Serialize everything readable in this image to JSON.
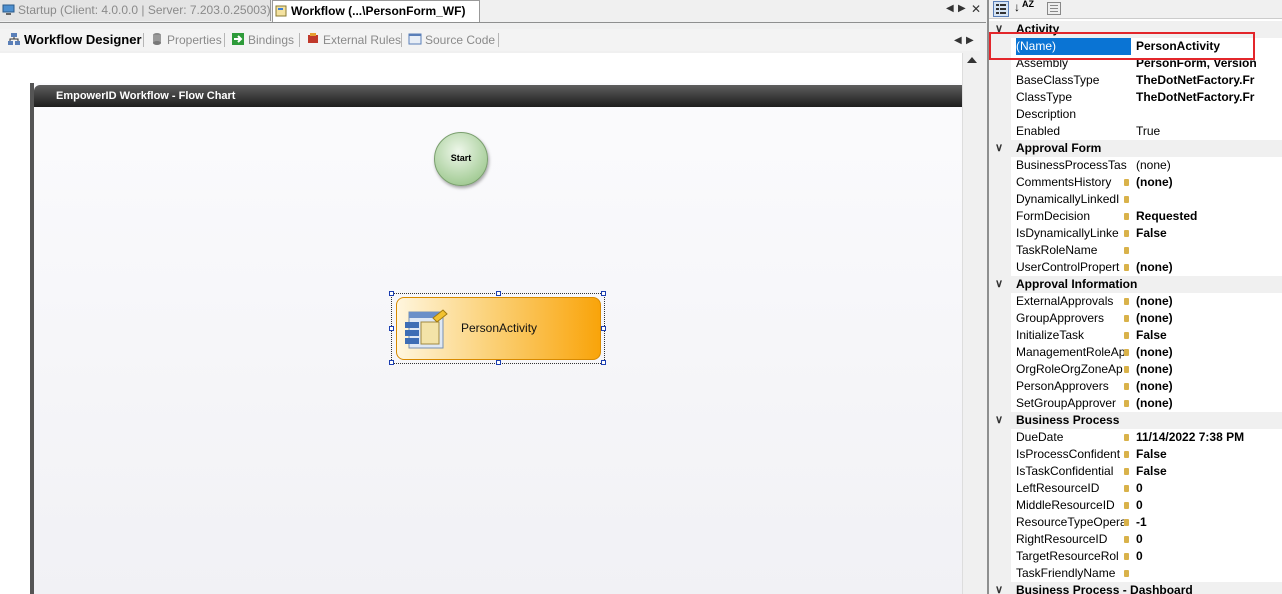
{
  "doc_tabs": [
    {
      "label": "Startup (Client: 4.0.0.0 | Server: 7.203.0.25003)",
      "active": false
    },
    {
      "label": "Workflow (...\\PersonForm_WF)",
      "active": true
    }
  ],
  "sub_tabs": [
    {
      "label": "Workflow Designer",
      "selected": true
    },
    {
      "label": "Properties",
      "selected": false
    },
    {
      "label": "Bindings",
      "selected": false
    },
    {
      "label": "External Rules",
      "selected": false
    },
    {
      "label": "Source Code",
      "selected": false
    }
  ],
  "flow": {
    "header": "EmpowerID Workflow - Flow Chart",
    "start_label": "Start",
    "activity_label": "PersonActivity"
  },
  "property_grid": {
    "rows": [
      {
        "type": "cat",
        "name": "Activity"
      },
      {
        "type": "prop",
        "name": "(Name)",
        "value": "PersonActivity",
        "bold": true,
        "lock": false,
        "selected": true
      },
      {
        "type": "prop",
        "name": "Assembly",
        "value": "PersonForm, Version",
        "bold": true,
        "lock": false
      },
      {
        "type": "prop",
        "name": "BaseClassType",
        "value": "TheDotNetFactory.Fr",
        "bold": true,
        "lock": false
      },
      {
        "type": "prop",
        "name": "ClassType",
        "value": "TheDotNetFactory.Fr",
        "bold": true,
        "lock": false
      },
      {
        "type": "prop",
        "name": "Description",
        "value": "",
        "bold": false,
        "lock": false
      },
      {
        "type": "prop",
        "name": "Enabled",
        "value": "True",
        "bold": false,
        "lock": false
      },
      {
        "type": "cat",
        "name": "Approval Form"
      },
      {
        "type": "prop",
        "name": "BusinessProcessTas",
        "value": "(none)",
        "bold": false,
        "lock": false
      },
      {
        "type": "prop",
        "name": "CommentsHistory",
        "value": "(none)",
        "bold": true,
        "lock": true
      },
      {
        "type": "prop",
        "name": "DynamicallyLinkedI",
        "value": "",
        "bold": false,
        "lock": true
      },
      {
        "type": "prop",
        "name": "FormDecision",
        "value": "Requested",
        "bold": true,
        "lock": true
      },
      {
        "type": "prop",
        "name": "IsDynamicallyLinke",
        "value": "False",
        "bold": true,
        "lock": true
      },
      {
        "type": "prop",
        "name": "TaskRoleName",
        "value": "",
        "bold": false,
        "lock": true
      },
      {
        "type": "prop",
        "name": "UserControlPropert",
        "value": "(none)",
        "bold": true,
        "lock": true
      },
      {
        "type": "cat",
        "name": "Approval Information"
      },
      {
        "type": "prop",
        "name": "ExternalApprovals",
        "value": "(none)",
        "bold": true,
        "lock": true
      },
      {
        "type": "prop",
        "name": "GroupApprovers",
        "value": "(none)",
        "bold": true,
        "lock": true
      },
      {
        "type": "prop",
        "name": "InitializeTask",
        "value": "False",
        "bold": true,
        "lock": true
      },
      {
        "type": "prop",
        "name": "ManagementRoleAp",
        "value": "(none)",
        "bold": true,
        "lock": true
      },
      {
        "type": "prop",
        "name": "OrgRoleOrgZoneAp",
        "value": "(none)",
        "bold": true,
        "lock": true
      },
      {
        "type": "prop",
        "name": "PersonApprovers",
        "value": "(none)",
        "bold": true,
        "lock": true
      },
      {
        "type": "prop",
        "name": "SetGroupApprover",
        "value": "(none)",
        "bold": true,
        "lock": true
      },
      {
        "type": "cat",
        "name": "Business Process"
      },
      {
        "type": "prop",
        "name": "DueDate",
        "value": "11/14/2022 7:38 PM",
        "bold": true,
        "lock": true
      },
      {
        "type": "prop",
        "name": "IsProcessConfident",
        "value": "False",
        "bold": true,
        "lock": true
      },
      {
        "type": "prop",
        "name": "IsTaskConfidential",
        "value": "False",
        "bold": true,
        "lock": true
      },
      {
        "type": "prop",
        "name": "LeftResourceID",
        "value": "0",
        "bold": true,
        "lock": true
      },
      {
        "type": "prop",
        "name": "MiddleResourceID",
        "value": "0",
        "bold": true,
        "lock": true
      },
      {
        "type": "prop",
        "name": "ResourceTypeOpera",
        "value": "-1",
        "bold": true,
        "lock": true
      },
      {
        "type": "prop",
        "name": "RightResourceID",
        "value": "0",
        "bold": true,
        "lock": true
      },
      {
        "type": "prop",
        "name": "TargetResourceRol",
        "value": "0",
        "bold": true,
        "lock": true
      },
      {
        "type": "prop",
        "name": "TaskFriendlyName",
        "value": "",
        "bold": false,
        "lock": true
      },
      {
        "type": "cat",
        "name": "Business Process - Dashboard"
      }
    ]
  },
  "colors": {
    "selection": "#0a74d4",
    "highlight_box": "#e3262b",
    "activity_orange": "#f9a40a",
    "start_green": "#a9cf9c"
  }
}
